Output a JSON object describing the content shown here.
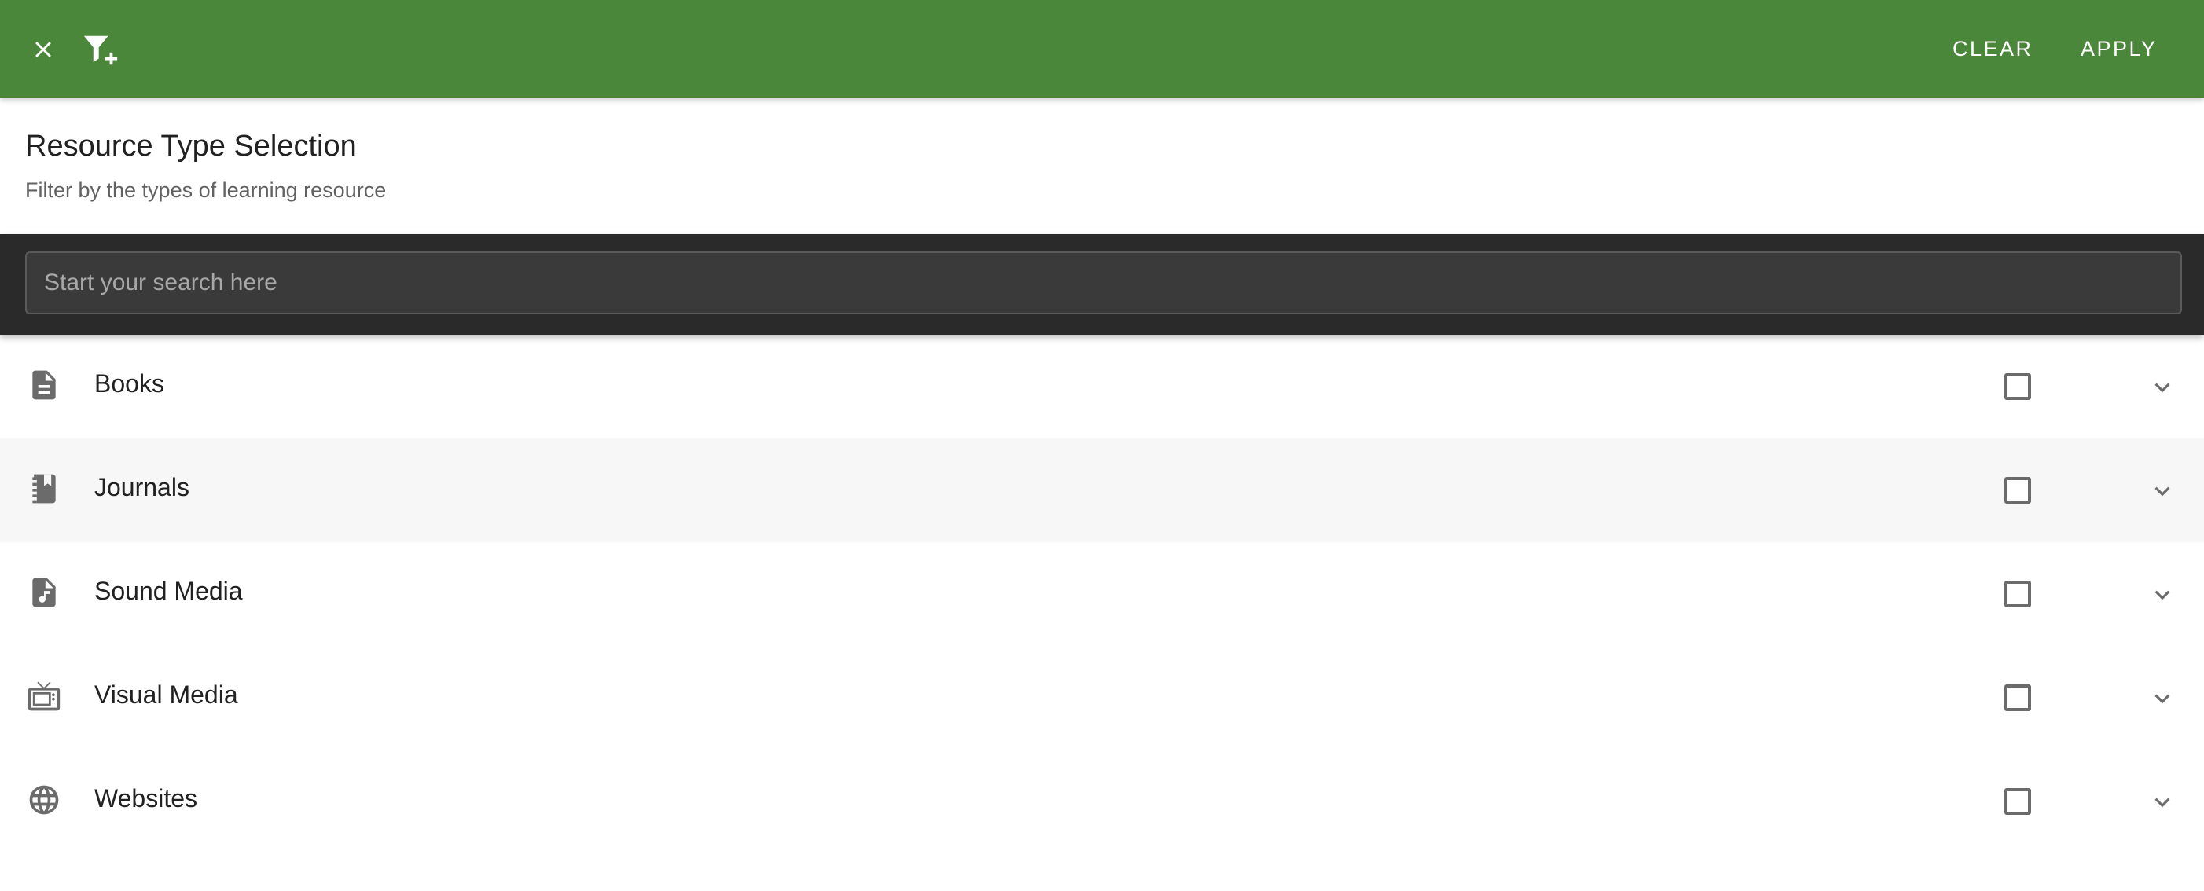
{
  "app_bar": {
    "background": "#4b873a",
    "close_icon": "close-icon",
    "filter_icon": "filter-add-icon",
    "clear_label": "CLEAR",
    "apply_label": "APPLY"
  },
  "header": {
    "title": "Resource Type Selection",
    "subtitle": "Filter by the types of learning resource"
  },
  "search": {
    "placeholder": "Start your search here",
    "value": ""
  },
  "items": [
    {
      "label": "Books",
      "icon": "document-icon",
      "checked": false
    },
    {
      "label": "Journals",
      "icon": "journal-icon",
      "checked": false
    },
    {
      "label": "Sound Media",
      "icon": "audio-file-icon",
      "checked": false
    },
    {
      "label": "Visual Media",
      "icon": "tv-icon",
      "checked": false
    },
    {
      "label": "Websites",
      "icon": "globe-icon",
      "checked": false
    }
  ]
}
